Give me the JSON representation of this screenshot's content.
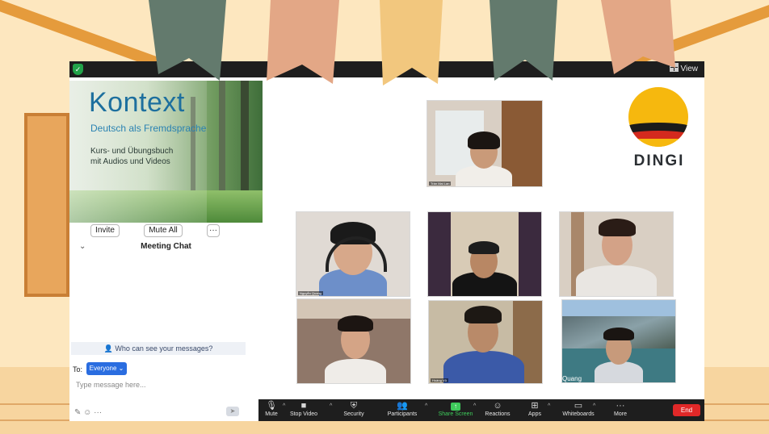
{
  "topbar": {
    "view_label": "View"
  },
  "slide": {
    "title": "Kontext",
    "subtitle": "Deutsch als Fremdsprache",
    "line1": "Kurs- und Übungsbuch",
    "line2": "mit Audios und Videos"
  },
  "participants_panel": {
    "invite_label": "Invite",
    "mute_all_label": "Mute All",
    "more_label": "···"
  },
  "chat": {
    "title": "Meeting Chat",
    "who_can_see": "Who can see your messages?",
    "to_label": "To:",
    "recipient": "Everyone",
    "placeholder": "Type message here...",
    "more_label": "···"
  },
  "videos": [
    {
      "name": "Trần Mai Lan"
    },
    {
      "name": "Nguyễn Quang"
    },
    {
      "name": ""
    },
    {
      "name": ""
    },
    {
      "name": ""
    },
    {
      "name": "Hoàng Vũ"
    },
    {
      "name": "Quang"
    }
  ],
  "logo": {
    "text": "DINGI"
  },
  "toolbar": {
    "items": [
      {
        "label": "Mute",
        "icon": "microphone-icon"
      },
      {
        "label": "Stop Video",
        "icon": "video-camera-icon"
      },
      {
        "label": "Security",
        "icon": "shield-icon"
      },
      {
        "label": "Participants",
        "icon": "people-icon"
      },
      {
        "label": "Share Screen",
        "icon": "share-screen-icon"
      },
      {
        "label": "Reactions",
        "icon": "reaction-icon"
      },
      {
        "label": "Apps",
        "icon": "apps-icon"
      },
      {
        "label": "Whiteboards",
        "icon": "whiteboard-icon"
      },
      {
        "label": "More",
        "icon": "more-icon"
      }
    ],
    "end_label": "End"
  },
  "colors": {
    "accent": "#2a6de0",
    "share_green": "#3ecb5b",
    "end_red": "#e02828",
    "pennant_green": "#637a6d",
    "pennant_peach": "#e3a786",
    "pennant_sand": "#f2c77e"
  }
}
